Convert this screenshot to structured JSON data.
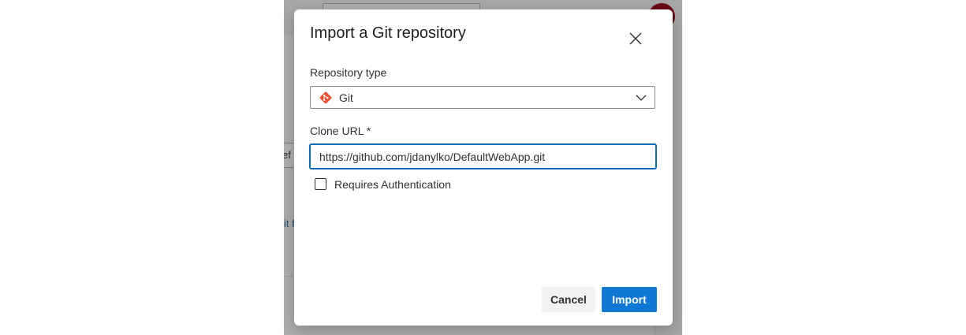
{
  "background": {
    "field_fragment": "ef",
    "link_fragment": "it f"
  },
  "dialog": {
    "title": "Import a Git repository",
    "repository_type": {
      "label": "Repository type",
      "selected": "Git",
      "icon": "git-icon"
    },
    "clone_url": {
      "label": "Clone URL *",
      "value": "https://github.com/jdanylko/DefaultWebApp.git"
    },
    "requires_auth": {
      "label": "Requires Authentication",
      "checked": false
    },
    "buttons": {
      "cancel": "Cancel",
      "import": "Import"
    }
  },
  "colors": {
    "accent": "#0f78d4",
    "focus_border": "#0f6cbd",
    "git_brand": "#f05133",
    "overlay": "#a8a8a8"
  }
}
